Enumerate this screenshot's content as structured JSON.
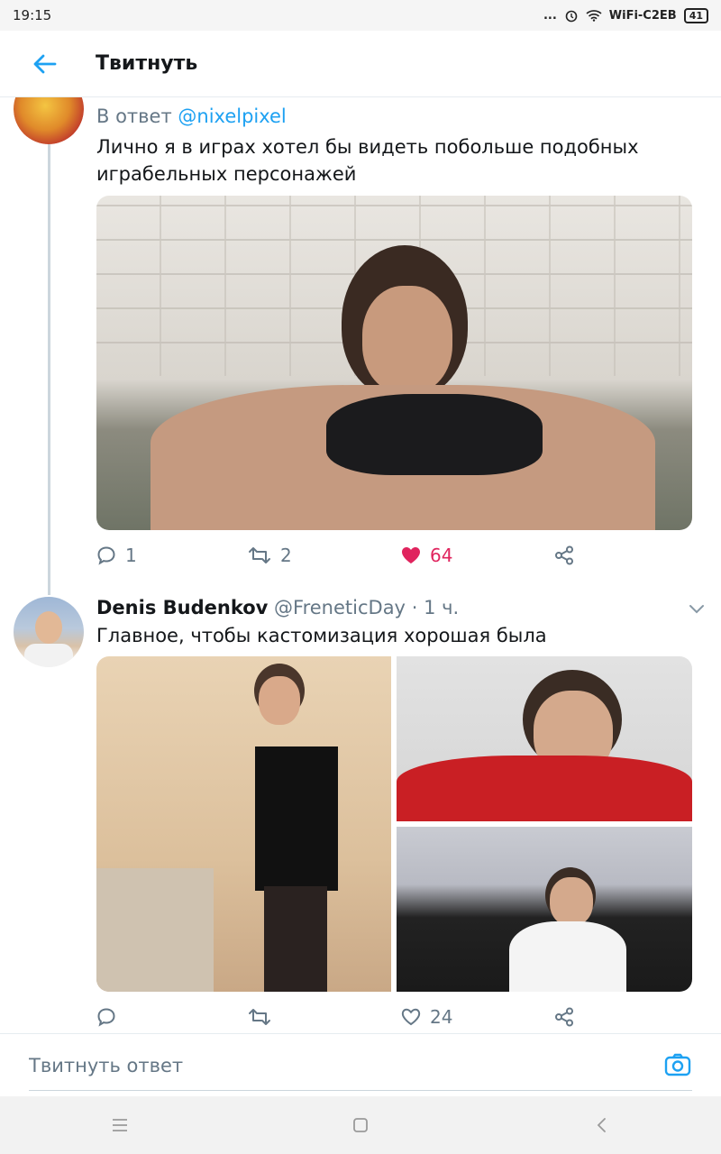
{
  "status": {
    "time": "19:15",
    "dots": "...",
    "wifi_name": "WiFi-C2EB",
    "battery": "41"
  },
  "appbar": {
    "title": "Твитнуть"
  },
  "tweet1": {
    "reply_prefix": "В ответ",
    "reply_to": "@nixelpixel",
    "text": "Лично я в играх хотел бы видеть побольше подобных играбельных персонажей",
    "replies": "1",
    "retweets": "2",
    "likes": "64"
  },
  "tweet2": {
    "author": "Denis Budenkov",
    "handle": "@FreneticDay",
    "separator": "·",
    "time": "1 ч.",
    "text": "Главное, чтобы кастомизация хорошая была",
    "replies": "",
    "retweets": "",
    "likes": "24"
  },
  "reply": {
    "placeholder": "Твитнуть ответ"
  },
  "colors": {
    "accent": "#1da1f2",
    "like": "#e0245e",
    "muted": "#657786"
  },
  "icons": [
    "arrow-left-icon",
    "comment-icon",
    "retweet-icon",
    "heart-icon",
    "share-icon",
    "chevron-down-icon",
    "camera-icon",
    "menu-icon",
    "home-square-icon",
    "back-triangle-icon",
    "wifi-icon",
    "alarm-icon"
  ]
}
